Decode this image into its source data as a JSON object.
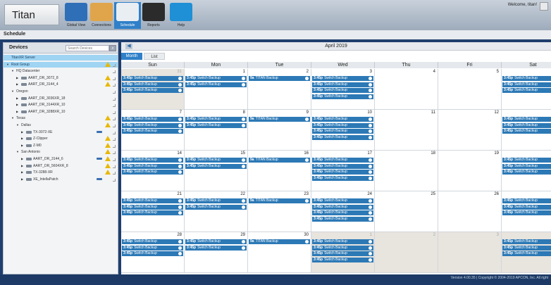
{
  "app": {
    "title": "Titan",
    "welcome": "Welcome, titan!"
  },
  "nav": [
    {
      "label": "Global View",
      "icon": "globe-icon",
      "color": "#2f6fb8"
    },
    {
      "label": "Connections",
      "icon": "connections-icon",
      "color": "#e0a54a"
    },
    {
      "label": "Schedule",
      "icon": "clock-icon",
      "color": "#e9eef3",
      "active": true
    },
    {
      "label": "Reports",
      "icon": "reports-icon",
      "color": "#2b2b2b"
    },
    {
      "label": "Help",
      "icon": "help-icon",
      "color": "#1f8fd6"
    }
  ],
  "page": {
    "title": "Schedule"
  },
  "devices": {
    "title": "Devices",
    "search_placeholder": "Search Devices",
    "tree": [
      {
        "label": "TitanXR Server",
        "indent": 0,
        "selected": true
      },
      {
        "label": "Root Group",
        "indent": 0,
        "caret": "▼",
        "warn": true,
        "grip": true,
        "selected": true
      },
      {
        "label": "HQ Datacenter",
        "indent": 1,
        "caret": "▼",
        "grip": true
      },
      {
        "label": "AART_DR_3072_8",
        "indent": 2,
        "caret": "▶",
        "device": true,
        "warn": true,
        "grip": true
      },
      {
        "label": "AART_DR_3144_4",
        "indent": 2,
        "caret": "▶",
        "device": true,
        "warn": true,
        "grip": true
      },
      {
        "label": "Oregon",
        "indent": 1,
        "caret": "▼",
        "grip": true
      },
      {
        "label": "AART_DR_3036XR_18",
        "indent": 2,
        "caret": "▶",
        "device": true,
        "grip": true
      },
      {
        "label": "AART_DR_3144XR_10",
        "indent": 2,
        "caret": "▶",
        "device": true,
        "grip": true
      },
      {
        "label": "AART_DR_3288XR_10",
        "indent": 2,
        "caret": "▶",
        "device": true,
        "grip": true
      },
      {
        "label": "Texas",
        "indent": 1,
        "caret": "▼",
        "warn": true,
        "grip": true
      },
      {
        "label": "Dallas",
        "indent": 2,
        "caret": "▼",
        "warn": true,
        "grip": true
      },
      {
        "label": "TX-3072-XE",
        "indent": 3,
        "caret": "▶",
        "device": true,
        "plug": true,
        "grip": true
      },
      {
        "label": "Z-Clipper",
        "indent": 3,
        "caret": "▶",
        "device": true,
        "warn": true,
        "grip": true
      },
      {
        "label": "Z-M0",
        "indent": 3,
        "caret": "▶",
        "device": true,
        "warn": true,
        "grip": true
      },
      {
        "label": "San Antonio",
        "indent": 2,
        "caret": "▼",
        "warn": true,
        "grip": true
      },
      {
        "label": "AART_DR_3144_6",
        "indent": 3,
        "caret": "▶",
        "device": true,
        "plug": true,
        "warn": true,
        "grip": true
      },
      {
        "label": "AART_DR_5604XR_8",
        "indent": 3,
        "caret": "▶",
        "device": true,
        "warn": true,
        "grip": true
      },
      {
        "label": "TX-3288-XR",
        "indent": 3,
        "caret": "▶",
        "device": true,
        "warn": true,
        "grip": true
      },
      {
        "label": "XE_IntellaPatch",
        "indent": 3,
        "caret": "▶",
        "device": true,
        "plug": true,
        "grip": true
      }
    ]
  },
  "calendar": {
    "month": "April 2019",
    "prev_icon": "◀",
    "tabs": [
      {
        "label": "Month"
      },
      {
        "label": "List"
      }
    ],
    "days": [
      "Sun",
      "Mon",
      "Tue",
      "Wed",
      "Thu",
      "Fri",
      "Sat"
    ],
    "event_time": "3:45p",
    "weeks": [
      [
        {
          "n": "31",
          "other": true,
          "events": [
            "Switch Backup",
            "Switch Backup",
            "Switch Backup"
          ],
          "time": "3:45p"
        },
        {
          "n": "1",
          "events": [
            "Switch Backup",
            "Switch Backup"
          ],
          "time": "3:45p"
        },
        {
          "n": "2",
          "events": [
            "TITAN Backup"
          ],
          "time": "9a"
        },
        {
          "n": "3",
          "events": [
            "Switch Backup",
            "Switch Backup",
            "Switch Backup",
            "Switch Backup"
          ],
          "time": "3:45p"
        },
        {
          "n": "4",
          "events": []
        },
        {
          "n": "5",
          "events": []
        },
        {
          "n": "6",
          "events": [
            "Switch Backup",
            "Switch Backup",
            "Switch Backup"
          ],
          "time": "3:45p"
        }
      ],
      [
        {
          "n": "7",
          "events": [
            "Switch Backup",
            "Switch Backup",
            "Switch Backup"
          ],
          "time": "3:45p"
        },
        {
          "n": "8",
          "events": [
            "Switch Backup",
            "Switch Backup"
          ],
          "time": "3:45p"
        },
        {
          "n": "9",
          "events": [
            "TITAN Backup"
          ],
          "time": "9a"
        },
        {
          "n": "10",
          "events": [
            "Switch Backup",
            "Switch Backup",
            "Switch Backup",
            "Switch Backup"
          ],
          "time": "3:45p"
        },
        {
          "n": "11",
          "events": []
        },
        {
          "n": "12",
          "events": []
        },
        {
          "n": "13",
          "events": [
            "Switch Backup",
            "Switch Backup",
            "Switch Backup"
          ],
          "time": "3:45p"
        }
      ],
      [
        {
          "n": "14",
          "events": [
            "Switch Backup",
            "Switch Backup",
            "Switch Backup"
          ],
          "time": "3:45p"
        },
        {
          "n": "15",
          "events": [
            "Switch Backup",
            "Switch Backup"
          ],
          "time": "3:45p"
        },
        {
          "n": "16",
          "events": [
            "TITAN Backup"
          ],
          "time": "9a"
        },
        {
          "n": "17",
          "events": [
            "Switch Backup",
            "Switch Backup",
            "Switch Backup",
            "Switch Backup"
          ],
          "time": "3:45p"
        },
        {
          "n": "18",
          "events": []
        },
        {
          "n": "19",
          "events": []
        },
        {
          "n": "20",
          "events": [
            "Switch Backup",
            "Switch Backup",
            "Switch Backup"
          ],
          "time": "3:45p"
        }
      ],
      [
        {
          "n": "21",
          "events": [
            "Switch Backup",
            "Switch Backup",
            "Switch Backup"
          ],
          "time": "3:45p"
        },
        {
          "n": "22",
          "events": [
            "Switch Backup",
            "Switch Backup"
          ],
          "time": "3:45p"
        },
        {
          "n": "23",
          "events": [
            "TITAN Backup"
          ],
          "time": "9a"
        },
        {
          "n": "24",
          "events": [
            "Switch Backup",
            "Switch Backup",
            "Switch Backup",
            "Switch Backup"
          ],
          "time": "3:45p"
        },
        {
          "n": "25",
          "events": []
        },
        {
          "n": "26",
          "events": []
        },
        {
          "n": "27",
          "events": [
            "Switch Backup",
            "Switch Backup",
            "Switch Backup"
          ],
          "time": "3:45p"
        }
      ],
      [
        {
          "n": "28",
          "events": [
            "Switch Backup",
            "Switch Backup",
            "Switch Backup"
          ],
          "time": "3:45p"
        },
        {
          "n": "29",
          "events": [
            "Switch Backup",
            "Switch Backup"
          ],
          "time": "3:45p"
        },
        {
          "n": "30",
          "events": [
            "TITAN Backup"
          ],
          "time": "9a"
        },
        {
          "n": "1",
          "other": true,
          "events": [
            "Switch Backup",
            "Switch Backup",
            "Switch Backup",
            "Switch Backup"
          ],
          "time": "3:45p"
        },
        {
          "n": "2",
          "other": true,
          "events": []
        },
        {
          "n": "3",
          "other": true,
          "events": []
        },
        {
          "n": "4",
          "other": true,
          "events": [
            "Switch Backup",
            "Switch Backup",
            "Switch Backup"
          ],
          "time": "3:45p"
        }
      ]
    ]
  },
  "footer": {
    "version": "Version 4.00.35 | Copyright © 2004-2019 APCON, Inc. All right"
  },
  "colors": {
    "accent": "#2f80c8",
    "event": "#2c79b6",
    "warning": "#e8b800",
    "selection": "#9fd4f2"
  }
}
